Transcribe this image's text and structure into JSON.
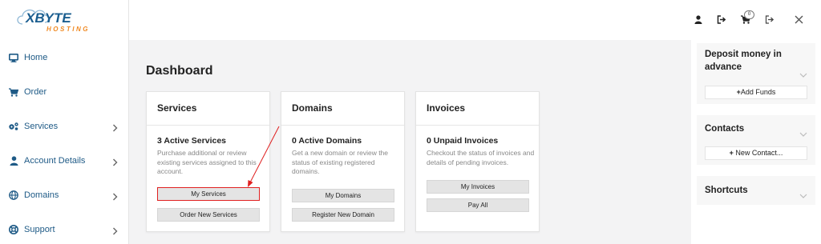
{
  "brand": {
    "logo_main": "XBYTE",
    "logo_sub": "HOSTING"
  },
  "sidebar": {
    "items": [
      {
        "label": "Home",
        "icon": "monitor-icon",
        "has_children": false
      },
      {
        "label": "Order",
        "icon": "cart-icon",
        "has_children": false
      },
      {
        "label": "Services",
        "icon": "cogs-icon",
        "has_children": true
      },
      {
        "label": "Account Details",
        "icon": "user-icon",
        "has_children": true
      },
      {
        "label": "Domains",
        "icon": "globe-icon",
        "has_children": true
      },
      {
        "label": "Support",
        "icon": "lifebuoy-icon",
        "has_children": true
      }
    ]
  },
  "topbar": {
    "cart_count": "0"
  },
  "main": {
    "title": "Dashboard",
    "cards": [
      {
        "title": "Services",
        "stat": "3 Active Services",
        "description": "Purchase additional or review existing services assigned to this account.",
        "buttons": [
          "My Services",
          "Order New Services"
        ]
      },
      {
        "title": "Domains",
        "stat": "0 Active Domains",
        "description": "Get a new domain or review the status of existing registered domains.",
        "buttons": [
          "My Domains",
          "Register New Domain"
        ]
      },
      {
        "title": "Invoices",
        "stat": "0 Unpaid Invoices",
        "description": "Checkout the status of invoices and details of pending invoices.",
        "buttons": [
          "My Invoices",
          "Pay All"
        ]
      }
    ]
  },
  "right_panel": {
    "deposit": {
      "title": "Deposit money in advance",
      "button": "Add Funds"
    },
    "contacts": {
      "title": "Contacts",
      "button": "New Contact..."
    },
    "shortcuts": {
      "title": "Shortcuts"
    }
  },
  "colors": {
    "nav_text": "#1e5a86",
    "logo_blue": "#1a5d8f",
    "logo_orange": "#f08a24",
    "annotation_red": "#e02020"
  }
}
